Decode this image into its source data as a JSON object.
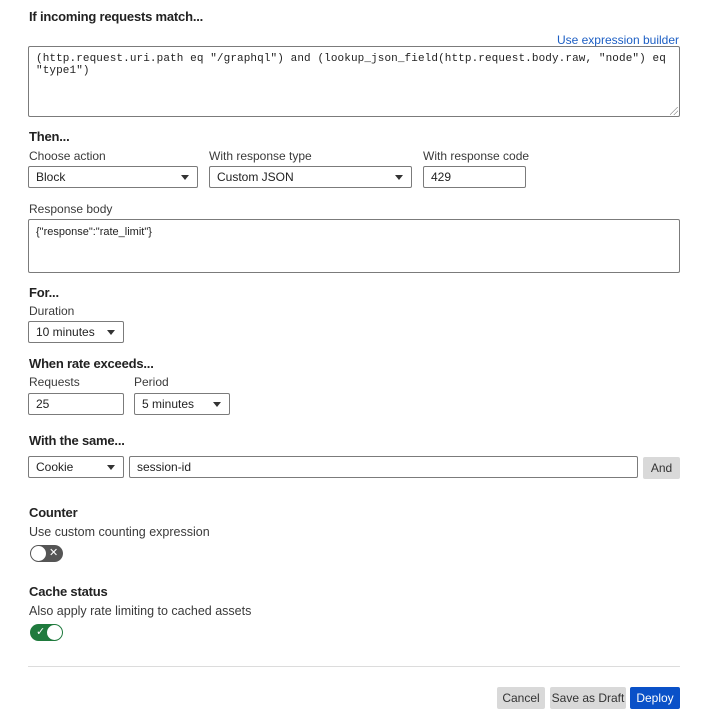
{
  "match": {
    "title": "If incoming requests match...",
    "expression_builder_link": "Use expression builder",
    "expression": "(http.request.uri.path eq \"/graphql\") and (lookup_json_field(http.request.body.raw, \"node\") eq \"type1\")"
  },
  "then": {
    "title": "Then...",
    "action_label": "Choose action",
    "action_value": "Block",
    "response_type_label": "With response type",
    "response_type_value": "Custom JSON",
    "response_code_label": "With response code",
    "response_code_value": "429",
    "response_body_label": "Response body",
    "response_body_value": "{\"response\":\"rate_limit\"}"
  },
  "for": {
    "title": "For...",
    "duration_label": "Duration",
    "duration_value": "10 minutes"
  },
  "rate": {
    "title": "When rate exceeds...",
    "requests_label": "Requests",
    "requests_value": "25",
    "period_label": "Period",
    "period_value": "5 minutes"
  },
  "same": {
    "title": "With the same...",
    "characteristic_value": "Cookie",
    "cookie_name_value": "session-id",
    "and_button": "And"
  },
  "counter": {
    "title": "Counter",
    "description": "Use custom counting expression",
    "toggle_state": "off",
    "toggle_glyph": "✕"
  },
  "cache": {
    "title": "Cache status",
    "description": "Also apply rate limiting to cached assets",
    "toggle_state": "on",
    "toggle_glyph": "✓"
  },
  "footer": {
    "cancel": "Cancel",
    "save_draft": "Save as Draft",
    "deploy": "Deploy"
  },
  "colors": {
    "primary": "#0a51c8",
    "link": "#1d5fc4",
    "toggle_on": "#1f7a3d",
    "toggle_off": "#555555"
  }
}
